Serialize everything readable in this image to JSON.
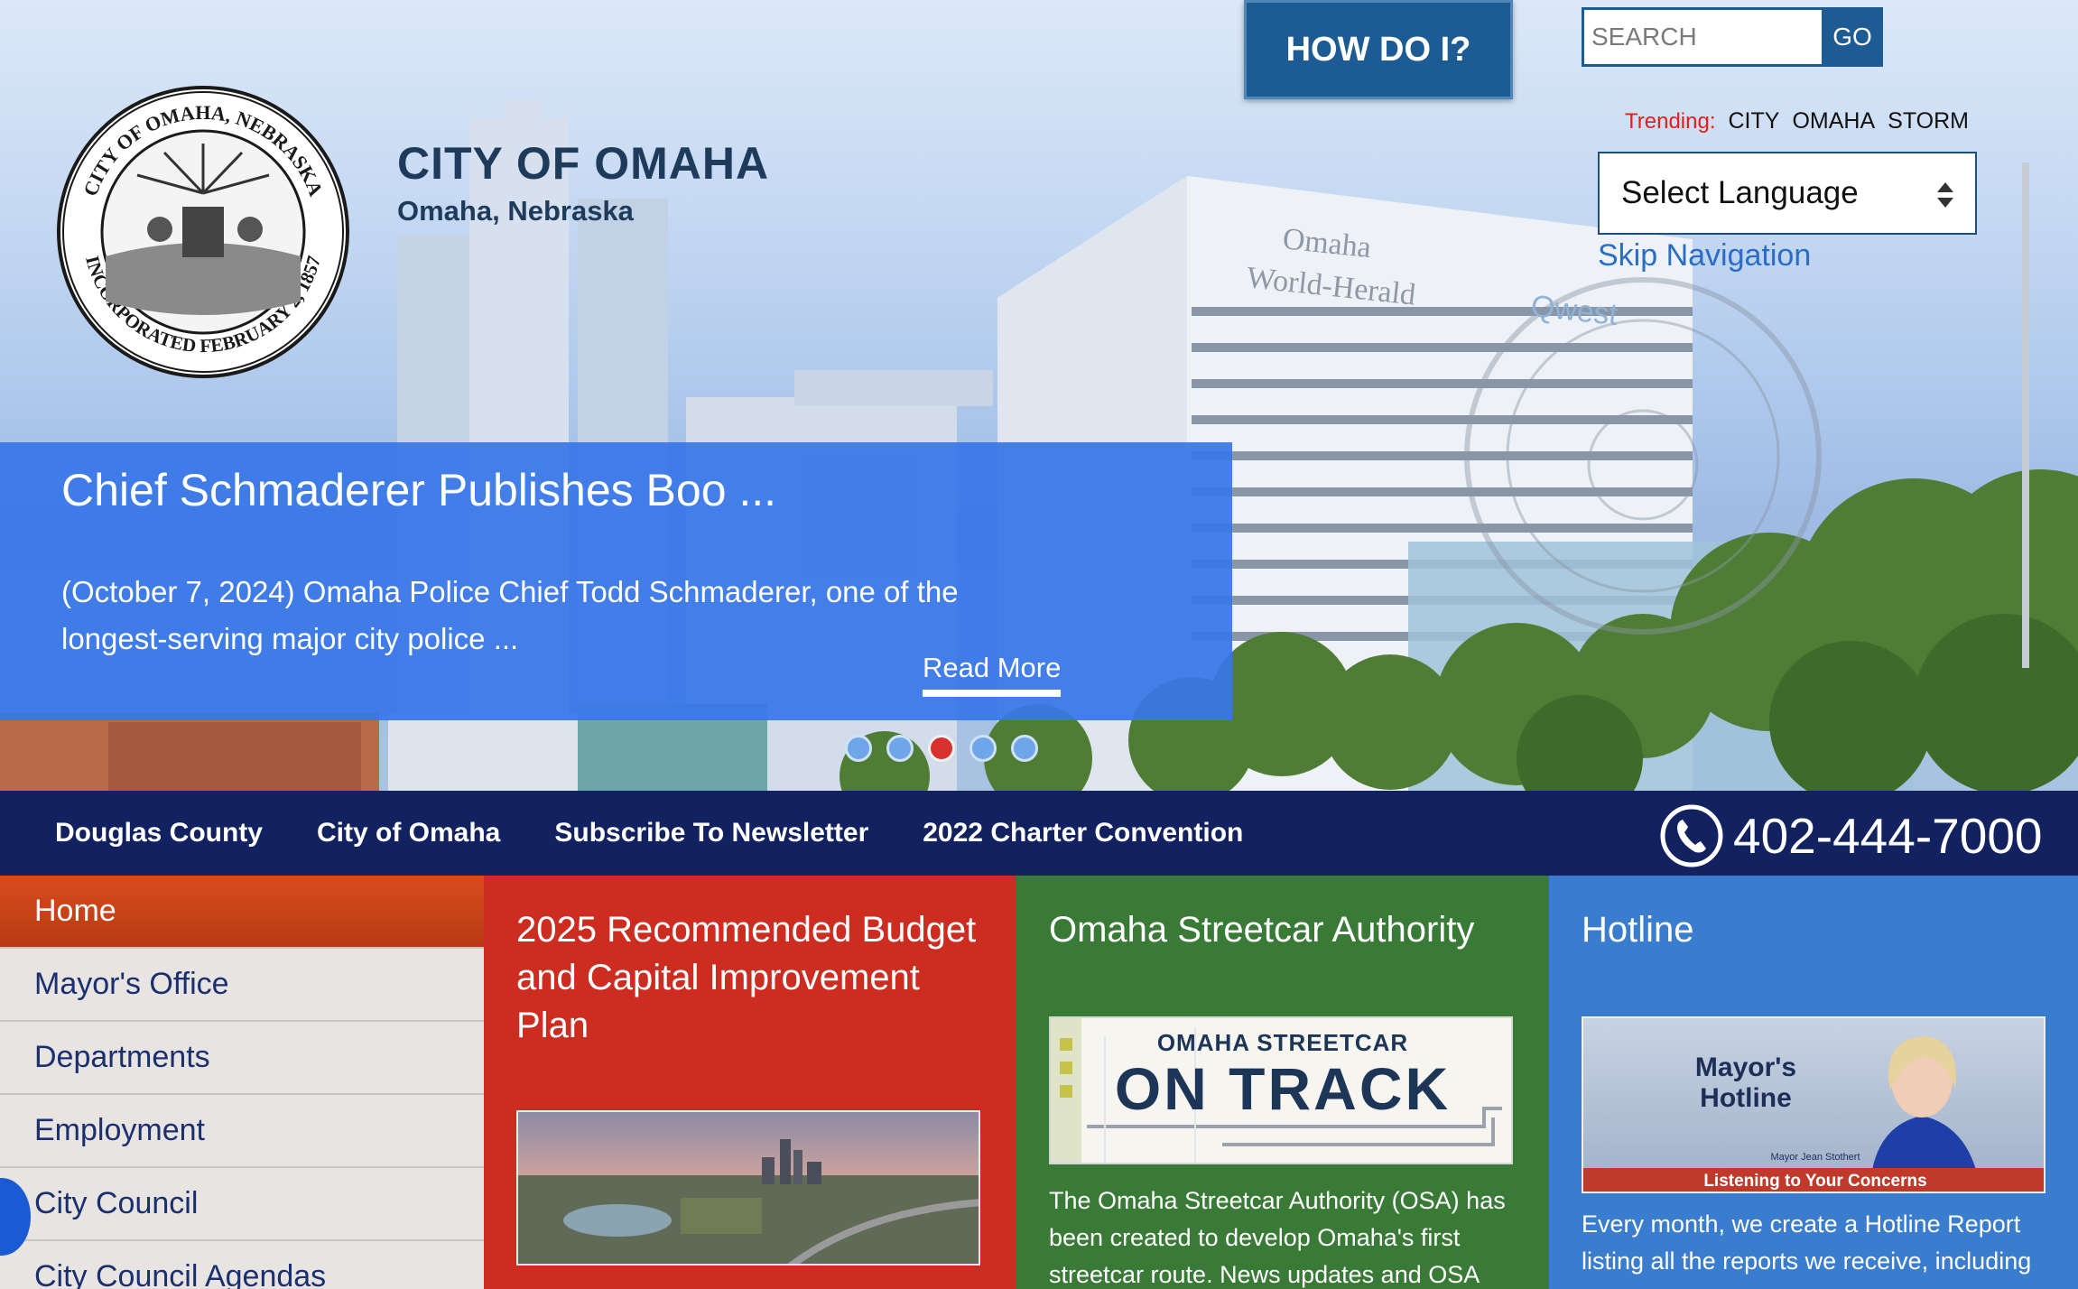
{
  "header": {
    "title": "CITY OF OMAHA",
    "subtitle": "Omaha, Nebraska",
    "seal_text_top": "CITY OF OMAHA, NEBRASKA",
    "seal_text_bottom": "INCORPORATED FEBRUARY 2, 1857",
    "how_do_i_label": "HOW DO I?"
  },
  "search": {
    "placeholder": "SEARCH",
    "go_label": "GO"
  },
  "trending": {
    "label": "Trending:",
    "items": [
      "CITY",
      "OMAHA",
      "STORM"
    ]
  },
  "language": {
    "selected": "Select Language"
  },
  "skip_nav_label": "Skip Navigation",
  "hero_background": {
    "building_sign_1": "Omaha World-Herald",
    "building_sign_2": "Qwest"
  },
  "slide": {
    "title": "Chief Schmaderer Publishes Boo ...",
    "body": "(October 7, 2024) Omaha Police Chief Todd Schmaderer, one of the longest-serving major city police ...",
    "read_more": "Read More",
    "dot_count": 5,
    "active_dot": 3
  },
  "navbar": {
    "links": [
      "Douglas County",
      "City of Omaha",
      "Subscribe To Newsletter",
      "2022 Charter Convention"
    ],
    "phone": "402-444-7000"
  },
  "sidebar": {
    "items": [
      "Home",
      "Mayor's Office",
      "Departments",
      "Employment",
      "City Council",
      "City Council Agendas"
    ],
    "active_index": 0
  },
  "tiles": {
    "budget": {
      "title": "2025 Recommended Budget and Capital Improvement Plan"
    },
    "streetcar": {
      "title": "Omaha Streetcar Authority",
      "image_line1": "OMAHA STREETCAR",
      "image_line2": "ON TRACK",
      "body": "The Omaha Streetcar Authority (OSA) has been created to develop Omaha's first streetcar route. News updates and OSA"
    },
    "hotline": {
      "title": "Hotline",
      "image_title": "Mayor's Hotline",
      "image_caption": "Listening to Your Concerns",
      "image_small": "Mayor Jean Stothert",
      "body": "Every month, we create a Hotline Report listing all the reports we receive, including"
    }
  },
  "colors": {
    "navy": "#12215f",
    "slide_blue": "#3876e8",
    "home_orange": "#c8431a",
    "tile_red": "#cd2c20",
    "tile_green": "#3a7a37",
    "tile_blue": "#3a7ccd"
  }
}
